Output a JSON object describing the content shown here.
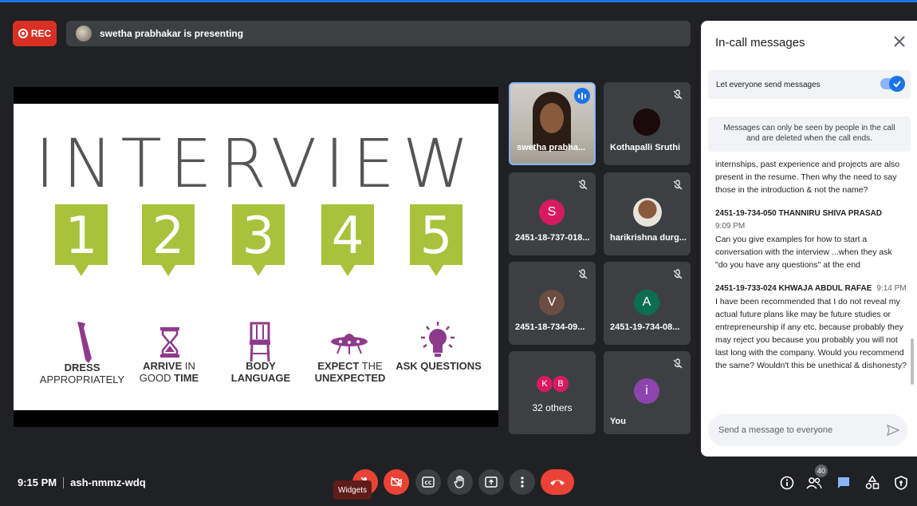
{
  "top_bar": {
    "rec_label": "REC",
    "presenter_text": "swetha prabhakar is presenting"
  },
  "slide": {
    "title": "INTERVIEW",
    "tips": [
      {
        "number": "1",
        "icon": "tie-icon",
        "line1_bold": "DRESS",
        "line2": "APPROPRIATELY",
        "line2_bold": ""
      },
      {
        "number": "2",
        "icon": "hourglass-icon",
        "line1_bold": "ARRIVE",
        "line1_rest": " IN",
        "line2": "GOOD ",
        "line2_bold": "TIME"
      },
      {
        "number": "3",
        "icon": "chair-icon",
        "line1_bold": "BODY",
        "line2": "",
        "line2_bold": "LANGUAGE"
      },
      {
        "number": "4",
        "icon": "ufo-icon",
        "line1_bold": "EXPECT",
        "line1_rest": " THE",
        "line2": "",
        "line2_bold": "UNEXPECTED"
      },
      {
        "number": "5",
        "icon": "lightbulb-icon",
        "line1_bold": "ASK QUESTIONS",
        "line2": "",
        "line2_bold": ""
      }
    ]
  },
  "participants": [
    {
      "name": "swetha prabha...",
      "type": "video",
      "speaking": true
    },
    {
      "name": "Kothapalli Sruthi",
      "type": "avatar-dark",
      "muted": true
    },
    {
      "name": "2451-18-737-018...",
      "initial": "S",
      "color": "#d81b60",
      "muted": true
    },
    {
      "name": "harikrishna durg...",
      "type": "photo",
      "muted": true
    },
    {
      "name": "2451-18-734-09...",
      "initial": "V",
      "color": "#6d4c41",
      "muted": true
    },
    {
      "name": "2451-19-734-08...",
      "initial": "A",
      "color": "#0b6e4f",
      "muted": true
    },
    {
      "name": "32 others",
      "initials": [
        "K",
        "B"
      ],
      "color": "#d81b60"
    },
    {
      "name": "You",
      "initial": "i",
      "color": "#8e44ad",
      "muted": true
    }
  ],
  "chat": {
    "title": "In-call messages",
    "toggle_label": "Let everyone send messages",
    "toggle_on": true,
    "info": "Messages can only be seen by people in the call and are deleted when the call ends.",
    "partial_message": "internships, past experience and projects are also present in the resume. Then why the need to say those in the introduction & not the name?",
    "messages": [
      {
        "sender": "2451-19-734-050 THANNIRU SHIVA PRASAD",
        "time": "9:09 PM",
        "text": "Can you give examples for how to start a conversation with the interview ...when they ask \"do you have any questions\" at the end"
      },
      {
        "sender": "2451-19-733-024 KHWAJA ABDUL RAFAE",
        "time": "9:14 PM",
        "text": "I have been recommended that I do not reveal my actual future plans like may be future studies or entrepreneurship if any etc, because probably they may reject you because you probably you will not last long with the company.  Would you recommend the same? Wouldn't this be unethical & dishonesty?"
      }
    ],
    "input_placeholder": "Send a message to everyone"
  },
  "bottom_bar": {
    "time": "9:15 PM",
    "meeting_code": "ash-nmmz-wdq",
    "tooltip": "Widgets",
    "participant_count": "40"
  },
  "colors": {
    "accent": "#1a73e8",
    "danger": "#ea4335",
    "slide_green": "#a8c23c",
    "slide_icon": "#8e3a8c"
  }
}
